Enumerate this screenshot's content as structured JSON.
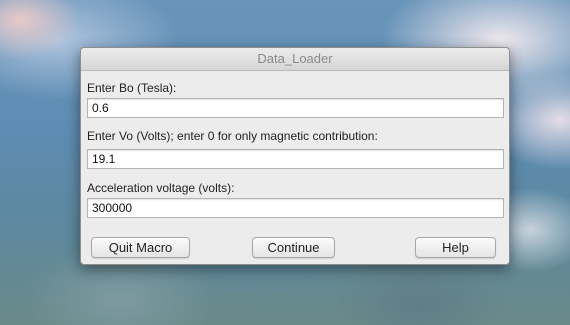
{
  "dialog": {
    "title": "Data_Loader",
    "fields": [
      {
        "label": "Enter Bo (Tesla):",
        "value": "0.6"
      },
      {
        "label": "Enter Vo (Volts); enter 0 for only magnetic contribution:",
        "value": "19.1"
      },
      {
        "label": "Acceleration voltage (volts):",
        "value": "300000"
      }
    ],
    "buttons": {
      "quit": "Quit Macro",
      "continue": "Continue",
      "help": "Help"
    }
  }
}
